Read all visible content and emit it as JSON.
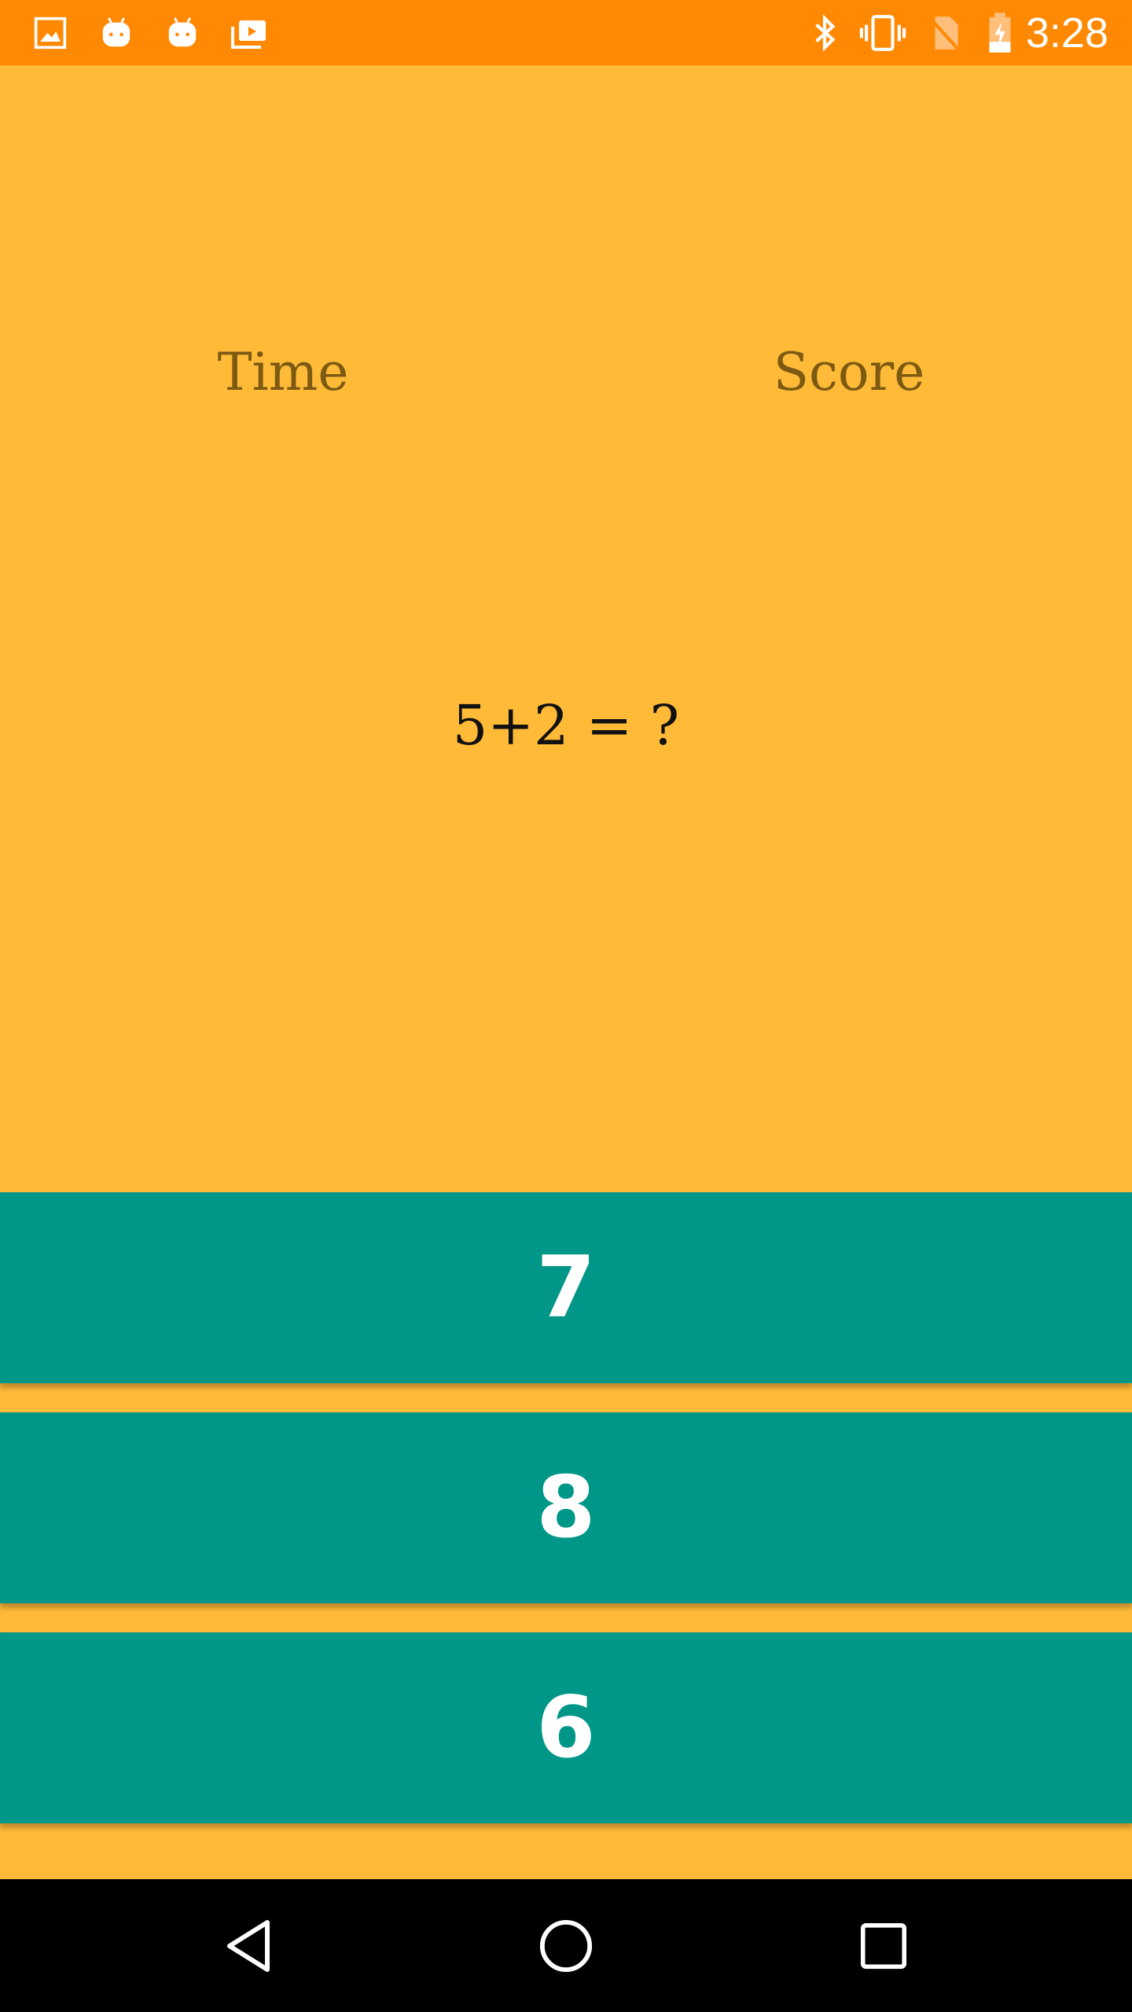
{
  "status_bar": {
    "time": "3:28",
    "left_icons": [
      "image-icon",
      "android-icon",
      "android-icon",
      "work-briefcase-icon"
    ],
    "right_icons": [
      "bluetooth-icon",
      "vibrate-icon",
      "no-sim-icon",
      "battery-charging-icon"
    ],
    "background": "#FF8902"
  },
  "game": {
    "time_label": "Time",
    "score_label": "Score",
    "question": "5+2 = ?",
    "answers": [
      "7",
      "8",
      "6"
    ]
  },
  "navigation": {
    "buttons": [
      "back-icon",
      "home-icon",
      "recents-icon"
    ]
  },
  "colors": {
    "background": "#FFBA38",
    "answer_button": "#009688",
    "label_text": "#7C5A12"
  }
}
